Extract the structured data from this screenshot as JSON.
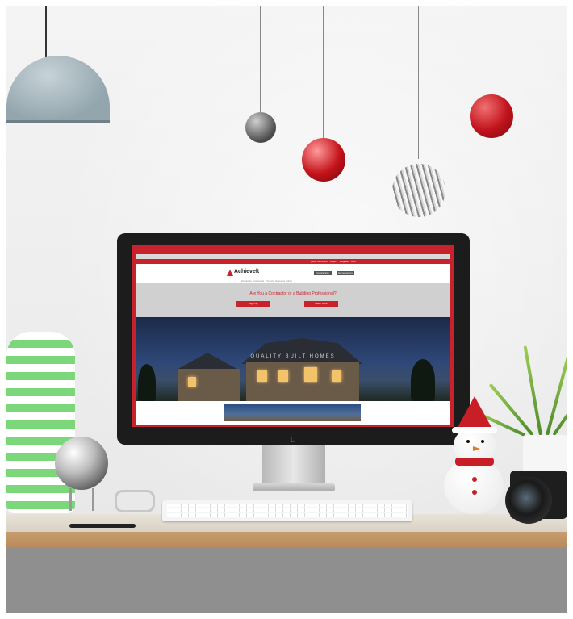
{
  "site": {
    "logo_text": "Achievelt",
    "topbar_links": [
      "(800) 555-0123",
      "Login",
      "Register",
      "Cart"
    ],
    "nav_buttons": [
      "Contractors",
      "Homeowners"
    ],
    "subnav": "Residential · Commercial · Products · Resources · About",
    "question": "Are You a Contractor or a Building Professional?",
    "cta_buttons": [
      "Sign Up",
      "Learn More"
    ],
    "hero_caption": "QUALITY BUILT HOMES"
  },
  "colors": {
    "brand_red": "#c8232c",
    "desk_wood": "#c89d6f"
  },
  "icons": {
    "apple_logo": "apple-icon"
  }
}
